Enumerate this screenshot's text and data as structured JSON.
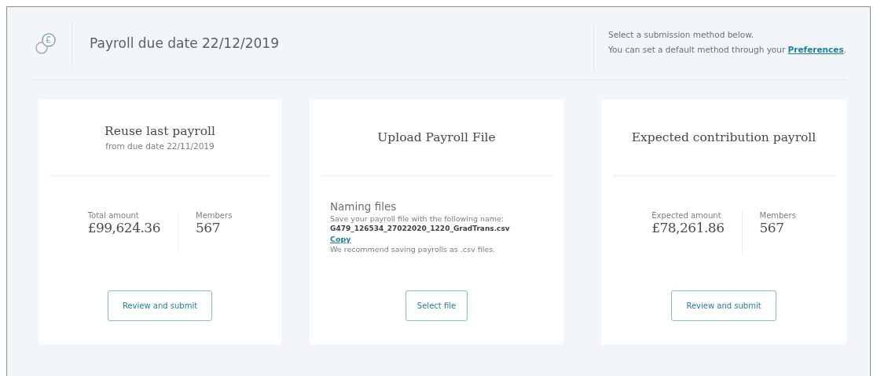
{
  "header": {
    "title": "Payroll due date 22/12/2019",
    "info_line1": "Select a submission method below.",
    "info_line2": "You can set a default method through your",
    "info_link": "Preferences",
    "info_end": "."
  },
  "cards": [
    {
      "kind": "summary",
      "title": "Reuse last payroll",
      "subtitle": "from due date 22/11/2019",
      "stats": [
        {
          "label": "Total amount",
          "value": "£99,624.36"
        },
        {
          "label": "Members",
          "value": "567"
        }
      ],
      "button": "Review and submit"
    },
    {
      "kind": "upload",
      "title": "Upload Payroll File",
      "heading": "Naming files",
      "instruction": "Save your payroll file with the following name:",
      "filename": "G479_126534_27022020_1220_GradTrans.csv",
      "copy_link": "Copy",
      "note": "We recommend saving payrolls as .csv files.",
      "button": "Select file"
    },
    {
      "kind": "summary",
      "title": "Expected contribution payroll",
      "stats": [
        {
          "label": "Expected amount",
          "value": "£78,261.86"
        },
        {
          "label": "Members",
          "value": "567"
        }
      ],
      "button": "Review and submit"
    }
  ]
}
